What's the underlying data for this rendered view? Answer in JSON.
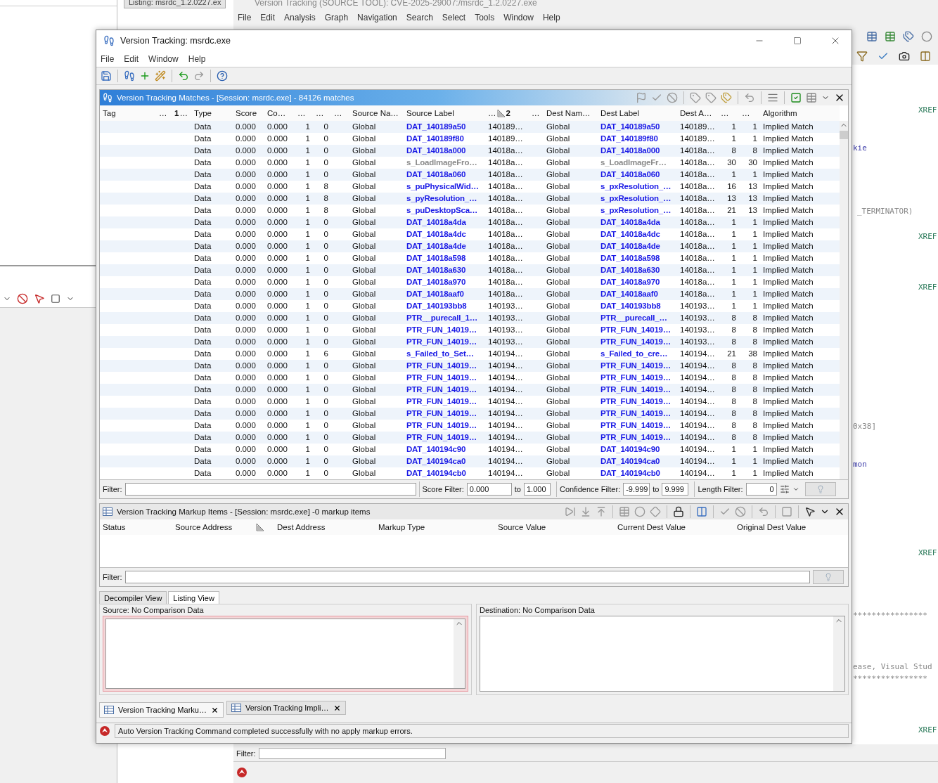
{
  "background": {
    "tool_title": "Version Tracking (SOURCE TOOL): CVE-2025-29007:/msrdc_1.2.0227.exe",
    "listing_tab": "Listing: msrdc_1.2.0227.ex",
    "menu": [
      "File",
      "Edit",
      "Analysis",
      "Graph",
      "Navigation",
      "Search",
      "Select",
      "Tools",
      "Window",
      "Help"
    ],
    "listing_texts": [
      {
        "text": "XREF",
        "kind": "xref"
      },
      {
        "text": "kie",
        "kind": "label"
      },
      {
        "text": "_TERMINATOR)",
        "kind": "code"
      },
      {
        "text": "XREF",
        "kind": "xref"
      },
      {
        "text": "XREF",
        "kind": "xref"
      },
      {
        "text": "0x38]",
        "kind": "code"
      },
      {
        "text": "mon",
        "kind": "label"
      },
      {
        "text": "XREF",
        "kind": "xref"
      },
      {
        "text": "****************",
        "kind": "code"
      },
      {
        "text": "ease, Visual Stud",
        "kind": "code"
      },
      {
        "text": "****************",
        "kind": "code"
      },
      {
        "text": "XREF",
        "kind": "xref"
      }
    ],
    "filter_label": "Filter:"
  },
  "window": {
    "title": "Version Tracking: msrdc.exe",
    "menu": [
      "File",
      "Edit",
      "Window",
      "Help"
    ]
  },
  "matches": {
    "title": "Version Tracking Matches - [Session: msrdc.exe] - 84126 matches",
    "columns": [
      {
        "label": "Tag"
      },
      {
        "label": "…"
      },
      {
        "label": "…",
        "sort_rank": "1"
      },
      {
        "label": "Type"
      },
      {
        "label": "Score"
      },
      {
        "label": "Co…"
      },
      {
        "label": "…"
      },
      {
        "label": "…"
      },
      {
        "label": "…"
      },
      {
        "label": "Source Na…"
      },
      {
        "label": "Source Label"
      },
      {
        "label": "…",
        "sort_rank": "2",
        "sort_icon": true
      },
      {
        "label": "…"
      },
      {
        "label": "Dest Nam…"
      },
      {
        "label": "Dest Label"
      },
      {
        "label": "Dest A…"
      },
      {
        "label": "…"
      },
      {
        "label": "…"
      },
      {
        "label": "Algorithm"
      }
    ],
    "rows": [
      {
        "type": "Data",
        "score": "0.000",
        "confidence": "0.000",
        "col_7": "1",
        "col_8": "0",
        "source_namespace": "Global",
        "source_label": "DAT_140189a50",
        "source_label_dimmed": false,
        "source_address": "140189…",
        "dest_namespace": "Global",
        "dest_label": "DAT_140189a50",
        "dest_label_dimmed": false,
        "dest_address": "140189…",
        "col_17": "1",
        "col_18": "1",
        "algorithm": "Implied Match"
      },
      {
        "type": "Data",
        "score": "0.000",
        "confidence": "0.000",
        "col_7": "1",
        "col_8": "0",
        "source_namespace": "Global",
        "source_label": "DAT_140189f80",
        "source_label_dimmed": false,
        "source_address": "140189…",
        "dest_namespace": "Global",
        "dest_label": "DAT_140189f80",
        "dest_label_dimmed": false,
        "dest_address": "140189…",
        "col_17": "1",
        "col_18": "1",
        "algorithm": "Implied Match"
      },
      {
        "type": "Data",
        "score": "0.000",
        "confidence": "0.000",
        "col_7": "1",
        "col_8": "0",
        "source_namespace": "Global",
        "source_label": "DAT_14018a000",
        "source_label_dimmed": false,
        "source_address": "14018a…",
        "dest_namespace": "Global",
        "dest_label": "DAT_14018a000",
        "dest_label_dimmed": false,
        "dest_address": "14018a…",
        "col_17": "8",
        "col_18": "8",
        "algorithm": "Implied Match"
      },
      {
        "type": "Data",
        "score": "0.000",
        "confidence": "0.000",
        "col_7": "1",
        "col_8": "0",
        "source_namespace": "Global",
        "source_label": "s_LoadImageFro…",
        "source_label_dimmed": true,
        "source_address": "14018a…",
        "dest_namespace": "Global",
        "dest_label": "s_LoadImageFr…",
        "dest_label_dimmed": true,
        "dest_address": "14018a…",
        "col_17": "30",
        "col_18": "30",
        "algorithm": "Implied Match"
      },
      {
        "type": "Data",
        "score": "0.000",
        "confidence": "0.000",
        "col_7": "1",
        "col_8": "0",
        "source_namespace": "Global",
        "source_label": "DAT_14018a060",
        "source_label_dimmed": false,
        "source_address": "14018a…",
        "dest_namespace": "Global",
        "dest_label": "DAT_14018a060",
        "dest_label_dimmed": false,
        "dest_address": "14018a…",
        "col_17": "1",
        "col_18": "1",
        "algorithm": "Implied Match"
      },
      {
        "type": "Data",
        "score": "0.000",
        "confidence": "0.000",
        "col_7": "1",
        "col_8": "8",
        "source_namespace": "Global",
        "source_label": "s_puPhysicalWid…",
        "source_label_dimmed": false,
        "source_address": "14018a…",
        "dest_namespace": "Global",
        "dest_label": "s_pxResolution_…",
        "dest_label_dimmed": false,
        "dest_address": "14018a…",
        "col_17": "16",
        "col_18": "13",
        "algorithm": "Implied Match"
      },
      {
        "type": "Data",
        "score": "0.000",
        "confidence": "0.000",
        "col_7": "1",
        "col_8": "8",
        "source_namespace": "Global",
        "source_label": "s_pyResolution_…",
        "source_label_dimmed": false,
        "source_address": "14018a…",
        "dest_namespace": "Global",
        "dest_label": "s_pxResolution_…",
        "dest_label_dimmed": false,
        "dest_address": "14018a…",
        "col_17": "13",
        "col_18": "13",
        "algorithm": "Implied Match"
      },
      {
        "type": "Data",
        "score": "0.000",
        "confidence": "0.000",
        "col_7": "1",
        "col_8": "8",
        "source_namespace": "Global",
        "source_label": "s_puDesktopSca…",
        "source_label_dimmed": false,
        "source_address": "14018a…",
        "dest_namespace": "Global",
        "dest_label": "s_pxResolution_…",
        "dest_label_dimmed": false,
        "dest_address": "14018a…",
        "col_17": "21",
        "col_18": "13",
        "algorithm": "Implied Match"
      },
      {
        "type": "Data",
        "score": "0.000",
        "confidence": "0.000",
        "col_7": "1",
        "col_8": "0",
        "source_namespace": "Global",
        "source_label": "DAT_14018a4da",
        "source_label_dimmed": false,
        "source_address": "14018a…",
        "dest_namespace": "Global",
        "dest_label": "DAT_14018a4da",
        "dest_label_dimmed": false,
        "dest_address": "14018a…",
        "col_17": "1",
        "col_18": "1",
        "algorithm": "Implied Match"
      },
      {
        "type": "Data",
        "score": "0.000",
        "confidence": "0.000",
        "col_7": "1",
        "col_8": "0",
        "source_namespace": "Global",
        "source_label": "DAT_14018a4dc",
        "source_label_dimmed": false,
        "source_address": "14018a…",
        "dest_namespace": "Global",
        "dest_label": "DAT_14018a4dc",
        "dest_label_dimmed": false,
        "dest_address": "14018a…",
        "col_17": "1",
        "col_18": "1",
        "algorithm": "Implied Match"
      },
      {
        "type": "Data",
        "score": "0.000",
        "confidence": "0.000",
        "col_7": "1",
        "col_8": "0",
        "source_namespace": "Global",
        "source_label": "DAT_14018a4de",
        "source_label_dimmed": false,
        "source_address": "14018a…",
        "dest_namespace": "Global",
        "dest_label": "DAT_14018a4de",
        "dest_label_dimmed": false,
        "dest_address": "14018a…",
        "col_17": "1",
        "col_18": "1",
        "algorithm": "Implied Match"
      },
      {
        "type": "Data",
        "score": "0.000",
        "confidence": "0.000",
        "col_7": "1",
        "col_8": "0",
        "source_namespace": "Global",
        "source_label": "DAT_14018a598",
        "source_label_dimmed": false,
        "source_address": "14018a…",
        "dest_namespace": "Global",
        "dest_label": "DAT_14018a598",
        "dest_label_dimmed": false,
        "dest_address": "14018a…",
        "col_17": "1",
        "col_18": "1",
        "algorithm": "Implied Match"
      },
      {
        "type": "Data",
        "score": "0.000",
        "confidence": "0.000",
        "col_7": "1",
        "col_8": "0",
        "source_namespace": "Global",
        "source_label": "DAT_14018a630",
        "source_label_dimmed": false,
        "source_address": "14018a…",
        "dest_namespace": "Global",
        "dest_label": "DAT_14018a630",
        "dest_label_dimmed": false,
        "dest_address": "14018a…",
        "col_17": "1",
        "col_18": "1",
        "algorithm": "Implied Match"
      },
      {
        "type": "Data",
        "score": "0.000",
        "confidence": "0.000",
        "col_7": "1",
        "col_8": "0",
        "source_namespace": "Global",
        "source_label": "DAT_14018a970",
        "source_label_dimmed": false,
        "source_address": "14018a…",
        "dest_namespace": "Global",
        "dest_label": "DAT_14018a970",
        "dest_label_dimmed": false,
        "dest_address": "14018a…",
        "col_17": "1",
        "col_18": "1",
        "algorithm": "Implied Match"
      },
      {
        "type": "Data",
        "score": "0.000",
        "confidence": "0.000",
        "col_7": "1",
        "col_8": "0",
        "source_namespace": "Global",
        "source_label": "DAT_14018aaf0",
        "source_label_dimmed": false,
        "source_address": "14018a…",
        "dest_namespace": "Global",
        "dest_label": "DAT_14018aaf0",
        "dest_label_dimmed": false,
        "dest_address": "14018a…",
        "col_17": "1",
        "col_18": "1",
        "algorithm": "Implied Match"
      },
      {
        "type": "Data",
        "score": "0.000",
        "confidence": "0.000",
        "col_7": "1",
        "col_8": "0",
        "source_namespace": "Global",
        "source_label": "DAT_140193bb8",
        "source_label_dimmed": false,
        "source_address": "140193…",
        "dest_namespace": "Global",
        "dest_label": "DAT_140193bb8",
        "dest_label_dimmed": false,
        "dest_address": "140193…",
        "col_17": "1",
        "col_18": "1",
        "algorithm": "Implied Match"
      },
      {
        "type": "Data",
        "score": "0.000",
        "confidence": "0.000",
        "col_7": "1",
        "col_8": "0",
        "source_namespace": "Global",
        "source_label": "PTR__purecall_1…",
        "source_label_dimmed": false,
        "source_address": "140193…",
        "dest_namespace": "Global",
        "dest_label": "PTR__purecall_…",
        "dest_label_dimmed": false,
        "dest_address": "140193…",
        "col_17": "8",
        "col_18": "8",
        "algorithm": "Implied Match"
      },
      {
        "type": "Data",
        "score": "0.000",
        "confidence": "0.000",
        "col_7": "1",
        "col_8": "0",
        "source_namespace": "Global",
        "source_label": "PTR_FUN_14019…",
        "source_label_dimmed": false,
        "source_address": "140193…",
        "dest_namespace": "Global",
        "dest_label": "PTR_FUN_14019…",
        "dest_label_dimmed": false,
        "dest_address": "140193…",
        "col_17": "8",
        "col_18": "8",
        "algorithm": "Implied Match"
      },
      {
        "type": "Data",
        "score": "0.000",
        "confidence": "0.000",
        "col_7": "1",
        "col_8": "0",
        "source_namespace": "Global",
        "source_label": "PTR_FUN_14019…",
        "source_label_dimmed": false,
        "source_address": "140193…",
        "dest_namespace": "Global",
        "dest_label": "PTR_FUN_14019…",
        "dest_label_dimmed": false,
        "dest_address": "140193…",
        "col_17": "8",
        "col_18": "8",
        "algorithm": "Implied Match"
      },
      {
        "type": "Data",
        "score": "0.000",
        "confidence": "0.000",
        "col_7": "1",
        "col_8": "6",
        "source_namespace": "Global",
        "source_label": "s_Failed_to_Set…",
        "source_label_dimmed": false,
        "source_address": "140194…",
        "dest_namespace": "Global",
        "dest_label": "s_Failed_to_cre…",
        "dest_label_dimmed": false,
        "dest_address": "140194…",
        "col_17": "21",
        "col_18": "38",
        "algorithm": "Implied Match"
      },
      {
        "type": "Data",
        "score": "0.000",
        "confidence": "0.000",
        "col_7": "1",
        "col_8": "0",
        "source_namespace": "Global",
        "source_label": "PTR_FUN_14019…",
        "source_label_dimmed": false,
        "source_address": "140194…",
        "dest_namespace": "Global",
        "dest_label": "PTR_FUN_14019…",
        "dest_label_dimmed": false,
        "dest_address": "140194…",
        "col_17": "8",
        "col_18": "8",
        "algorithm": "Implied Match"
      },
      {
        "type": "Data",
        "score": "0.000",
        "confidence": "0.000",
        "col_7": "1",
        "col_8": "0",
        "source_namespace": "Global",
        "source_label": "PTR_FUN_14019…",
        "source_label_dimmed": false,
        "source_address": "140194…",
        "dest_namespace": "Global",
        "dest_label": "PTR_FUN_14019…",
        "dest_label_dimmed": false,
        "dest_address": "140194…",
        "col_17": "8",
        "col_18": "8",
        "algorithm": "Implied Match"
      },
      {
        "type": "Data",
        "score": "0.000",
        "confidence": "0.000",
        "col_7": "1",
        "col_8": "0",
        "source_namespace": "Global",
        "source_label": "PTR_FUN_14019…",
        "source_label_dimmed": false,
        "source_address": "140194…",
        "dest_namespace": "Global",
        "dest_label": "PTR_FUN_14019…",
        "dest_label_dimmed": false,
        "dest_address": "140194…",
        "col_17": "8",
        "col_18": "8",
        "algorithm": "Implied Match"
      },
      {
        "type": "Data",
        "score": "0.000",
        "confidence": "0.000",
        "col_7": "1",
        "col_8": "0",
        "source_namespace": "Global",
        "source_label": "PTR_FUN_14019…",
        "source_label_dimmed": false,
        "source_address": "140194…",
        "dest_namespace": "Global",
        "dest_label": "PTR_FUN_14019…",
        "dest_label_dimmed": false,
        "dest_address": "140194…",
        "col_17": "8",
        "col_18": "8",
        "algorithm": "Implied Match"
      },
      {
        "type": "Data",
        "score": "0.000",
        "confidence": "0.000",
        "col_7": "1",
        "col_8": "0",
        "source_namespace": "Global",
        "source_label": "PTR_FUN_14019…",
        "source_label_dimmed": false,
        "source_address": "140194…",
        "dest_namespace": "Global",
        "dest_label": "PTR_FUN_14019…",
        "dest_label_dimmed": false,
        "dest_address": "140194…",
        "col_17": "8",
        "col_18": "8",
        "algorithm": "Implied Match"
      },
      {
        "type": "Data",
        "score": "0.000",
        "confidence": "0.000",
        "col_7": "1",
        "col_8": "0",
        "source_namespace": "Global",
        "source_label": "PTR_FUN_14019…",
        "source_label_dimmed": false,
        "source_address": "140194…",
        "dest_namespace": "Global",
        "dest_label": "PTR_FUN_14019…",
        "dest_label_dimmed": false,
        "dest_address": "140194…",
        "col_17": "8",
        "col_18": "8",
        "algorithm": "Implied Match"
      },
      {
        "type": "Data",
        "score": "0.000",
        "confidence": "0.000",
        "col_7": "1",
        "col_8": "0",
        "source_namespace": "Global",
        "source_label": "PTR_FUN_14019…",
        "source_label_dimmed": false,
        "source_address": "140194…",
        "dest_namespace": "Global",
        "dest_label": "PTR_FUN_14019…",
        "dest_label_dimmed": false,
        "dest_address": "140194…",
        "col_17": "8",
        "col_18": "8",
        "algorithm": "Implied Match"
      },
      {
        "type": "Data",
        "score": "0.000",
        "confidence": "0.000",
        "col_7": "1",
        "col_8": "0",
        "source_namespace": "Global",
        "source_label": "DAT_140194c90",
        "source_label_dimmed": false,
        "source_address": "140194…",
        "dest_namespace": "Global",
        "dest_label": "DAT_140194c90",
        "dest_label_dimmed": false,
        "dest_address": "140194…",
        "col_17": "1",
        "col_18": "1",
        "algorithm": "Implied Match"
      },
      {
        "type": "Data",
        "score": "0.000",
        "confidence": "0.000",
        "col_7": "1",
        "col_8": "0",
        "source_namespace": "Global",
        "source_label": "DAT_140194ca0",
        "source_label_dimmed": false,
        "source_address": "140194…",
        "dest_namespace": "Global",
        "dest_label": "DAT_140194ca0",
        "dest_label_dimmed": false,
        "dest_address": "140194…",
        "col_17": "1",
        "col_18": "1",
        "algorithm": "Implied Match"
      },
      {
        "type": "Data",
        "score": "0.000",
        "confidence": "0.000",
        "col_7": "1",
        "col_8": "0",
        "source_namespace": "Global",
        "source_label": "DAT_140194cb0",
        "source_label_dimmed": false,
        "source_address": "140194…",
        "dest_namespace": "Global",
        "dest_label": "DAT_140194cb0",
        "dest_label_dimmed": false,
        "dest_address": "140194…",
        "col_17": "1",
        "col_18": "1",
        "algorithm": "Implied Match"
      }
    ],
    "filter": {
      "label": "Filter:",
      "score_label": "Score Filter:",
      "score_min": "0.000",
      "score_to": "to",
      "score_max": "1.000",
      "confidence_label": "Confidence Filter:",
      "confidence_min": "-9.999",
      "confidence_to": "to",
      "confidence_max": "9.999",
      "length_label": "Length Filter:",
      "length": "0"
    }
  },
  "markup": {
    "title": "Version Tracking Markup Items - [Session: msrdc.exe] -0 markup items",
    "columns": [
      {
        "label": "Status"
      },
      {
        "label": "Source Address"
      },
      {
        "sort_icon": true
      },
      {
        "label": "Dest Address"
      },
      {
        "label": "Markup Type"
      },
      {
        "label": "Source Value"
      },
      {
        "label": "Current Dest Value"
      },
      {
        "label": "Original Dest Value"
      }
    ],
    "filter_label": "Filter:"
  },
  "compare": {
    "tabs": [
      {
        "label": "Decompiler View",
        "selected": false
      },
      {
        "label": "Listing View",
        "selected": true
      }
    ],
    "source_title": "Source: No Comparison Data",
    "destination_title": "Destination: No Comparison Data"
  },
  "bottom_tabs": [
    {
      "label": "Version Tracking Marku…",
      "selected": true
    },
    {
      "label": "Version Tracking Impli…",
      "selected": false
    }
  ],
  "status": "Auto Version Tracking Command completed successfully with no apply markup errors."
}
